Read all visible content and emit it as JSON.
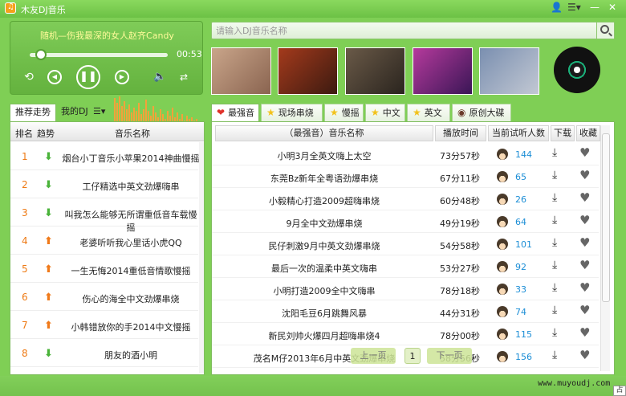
{
  "window": {
    "title": "木友DJ音乐"
  },
  "player": {
    "now_playing": "随机—伤我最深的女人赵齐Candy",
    "elapsed": "00:53",
    "progress": 0.08
  },
  "search": {
    "placeholder": "请输入DJ音乐名称"
  },
  "banners": [
    {
      "name": "banner-1",
      "colors": [
        "#c9a58a",
        "#8a6450"
      ]
    },
    {
      "name": "banner-2",
      "colors": [
        "#a43a1c",
        "#3c1a10"
      ]
    },
    {
      "name": "banner-3",
      "colors": [
        "#6a5a48",
        "#2a241e"
      ]
    },
    {
      "name": "banner-4",
      "colors": [
        "#b53a9c",
        "#3a1656"
      ]
    },
    {
      "name": "banner-5",
      "colors": [
        "#7a8fb0",
        "#c2c8d3"
      ]
    }
  ],
  "left_tabs": {
    "recommend": "推荐走势",
    "mydj": "我的DJ",
    "menu": "☰▾"
  },
  "left_table": {
    "headers": {
      "rank": "排名",
      "trend": "趋势",
      "name": "音乐名称"
    },
    "rows": [
      {
        "rank": "1",
        "trend": "down",
        "name": "烟台小丁音乐小苹果2014神曲慢摇"
      },
      {
        "rank": "2",
        "trend": "down",
        "name": "工仔精选中英文劲爆嗨串"
      },
      {
        "rank": "3",
        "trend": "down",
        "name": "叫我怎么能够无所谓重低音车载慢摇"
      },
      {
        "rank": "4",
        "trend": "up",
        "name": "老婆听听我心里话小虎QQ"
      },
      {
        "rank": "5",
        "trend": "up",
        "name": "一生无悔2014重低音情歌慢摇"
      },
      {
        "rank": "6",
        "trend": "up",
        "name": "伤心的海全中文劲爆串烧"
      },
      {
        "rank": "7",
        "trend": "up",
        "name": "小韩错放你的手2014中文慢摇"
      },
      {
        "rank": "8",
        "trend": "down",
        "name": "朋友的酒小明"
      }
    ]
  },
  "right_tabs": [
    {
      "name": "tab-strongest",
      "icon": "heart-icon",
      "glyph": "❤",
      "color": "#e0322b",
      "label": "最强音"
    },
    {
      "name": "tab-live-mix",
      "icon": "star-icon",
      "glyph": "★",
      "color": "#f2c21b",
      "label": "现场串烧"
    },
    {
      "name": "tab-slow",
      "icon": "star-icon",
      "glyph": "★",
      "color": "#f2c21b",
      "label": "慢摇"
    },
    {
      "name": "tab-chinese",
      "icon": "star-icon",
      "glyph": "★",
      "color": "#f2c21b",
      "label": "中文"
    },
    {
      "name": "tab-english",
      "icon": "star-icon",
      "glyph": "★",
      "color": "#f2c21b",
      "label": "英文"
    },
    {
      "name": "tab-original",
      "icon": "disc-icon",
      "glyph": "◉",
      "color": "#6b3a2a",
      "label": "原创大碟"
    }
  ],
  "right_table": {
    "headers": {
      "name": "（最强音）音乐名称",
      "duration": "播放时间",
      "listeners": "当前试听人数",
      "download": "下载",
      "favorite": "收藏"
    },
    "rows": [
      {
        "name": "小明3月全英文嗨上太空",
        "duration": "73分57秒",
        "listeners": "144"
      },
      {
        "name": "东莞Bz新年全粤语劲爆串烧",
        "duration": "67分11秒",
        "listeners": "65"
      },
      {
        "name": "小毅精心打造2009超嗨串烧",
        "duration": "60分48秒",
        "listeners": "26"
      },
      {
        "name": "9月全中文劲爆串烧",
        "duration": "49分19秒",
        "listeners": "64"
      },
      {
        "name": "民仔刺激9月中英文劲爆串烧",
        "duration": "54分58秒",
        "listeners": "101"
      },
      {
        "name": "最后一次的温柔中英文嗨串",
        "duration": "53分27秒",
        "listeners": "92"
      },
      {
        "name": "小明打造2009全中文嗨串",
        "duration": "78分18秒",
        "listeners": "33"
      },
      {
        "name": "沈阳毛豆6月跳舞风暴",
        "duration": "44分31秒",
        "listeners": "74"
      },
      {
        "name": "新民刘帅火爆四月超嗨串烧4",
        "duration": "78分00秒",
        "listeners": "115"
      },
      {
        "name": "茂名M仔2013年6月中英文劲爆串烧",
        "duration": "58分56秒",
        "listeners": "156"
      }
    ]
  },
  "pager": {
    "prev": "上一页",
    "page": "1",
    "next": "下一页"
  },
  "footer": {
    "website": "www.muyoudj.com",
    "corner": "占"
  }
}
